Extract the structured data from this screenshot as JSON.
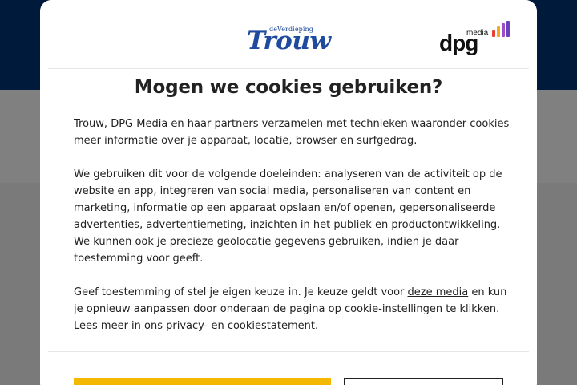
{
  "modal": {
    "brand": {
      "trouw_tagline": "deVerdieping",
      "trouw_name": "Trouw",
      "dpg_media_word": "media",
      "dpg_word": "dpg",
      "dpg_bar_colors": [
        "#e8402f",
        "#f5a623",
        "#9b4dca",
        "#6d3fb8"
      ]
    },
    "title": "Mogen we cookies gebruiken?",
    "paragraph1": {
      "t1": "Trouw, ",
      "link_dpg": "DPG Media",
      "t2": " en haar",
      "link_partners": " partners",
      "t3": " verzamelen met technieken waaronder cookies meer informatie over je apparaat, locatie, browser en surfgedrag."
    },
    "paragraph2": "We gebruiken dit voor de volgende doeleinden: analyseren van de activiteit op de website en app, integreren van social media, personaliseren van content en marketing, informatie op een apparaat opslaan en/of openen, gepersonaliseerde advertenties, advertentiemeting, inzichten in het publiek en productontwikkeling. We kunnen ook je precieze geolocatie gegevens gebruiken, indien je daar toestemming voor geeft.",
    "paragraph3": {
      "t1": "Geef toestemming of stel je eigen keuze in. Je keuze geldt voor ",
      "link_media": "deze media",
      "t2": " en kun je opnieuw aanpassen door onderaan de pagina op cookie-instellingen te klikken. Lees meer in ons ",
      "link_privacy": "privacy-",
      "t3": " en ",
      "link_cookie": "cookiestatement",
      "t4": "."
    },
    "accept_label": "",
    "settings_label": ""
  },
  "colors": {
    "header_bg": "#001a3c",
    "accent_yellow": "#f5b800",
    "trouw_blue": "#1f4b9e"
  }
}
